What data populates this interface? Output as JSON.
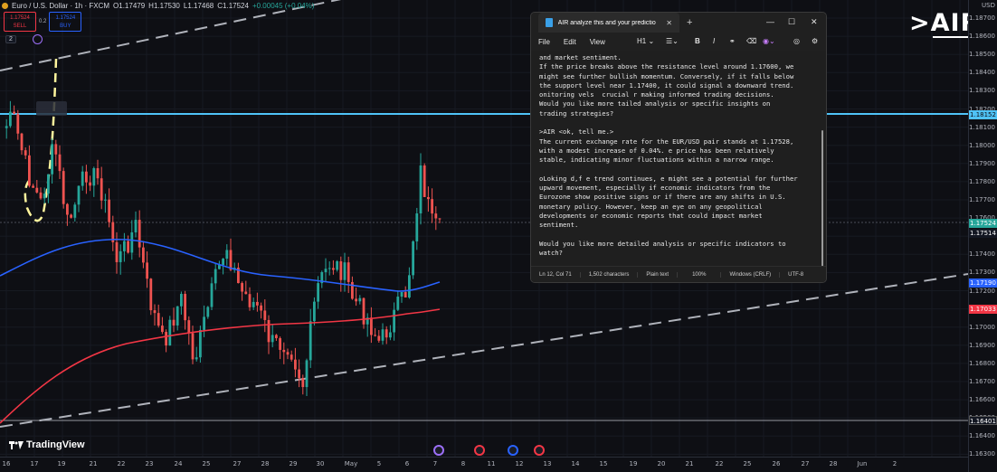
{
  "symbol": {
    "title": "Euro / U.S. Dollar · 1h · FXCM",
    "open": "O1.17479",
    "high": "H1.17530",
    "low": "L1.17468",
    "close": "C1.17524",
    "change": "+0.00045 (+0.04%)"
  },
  "trade": {
    "sell_price": "1.17524",
    "sell_label": "SELL",
    "spread": "0.2",
    "buy_price": "1.17524",
    "buy_label": "BUY"
  },
  "indicators_count": "2",
  "air_logo": ">AIR",
  "tradingview_logo": "TradingView",
  "currency": "USD",
  "price_ticks": [
    "1.18700",
    "1.18600",
    "1.18500",
    "1.18400",
    "1.18300",
    "1.18200",
    "1.18100",
    "1.18000",
    "1.17900",
    "1.17800",
    "1.17700",
    "1.17600",
    "1.17500",
    "1.17400",
    "1.17300",
    "1.17200",
    "1.17100",
    "1.17000",
    "1.16900",
    "1.16800",
    "1.16700",
    "1.16600",
    "1.16500",
    "1.16400",
    "1.16300"
  ],
  "price_tags": {
    "resistance": "1.18152",
    "current": "1.17524",
    "current2": "1.17514",
    "ma_blue": "1.17190",
    "ma_red": "1.17033",
    "support": "1.16401"
  },
  "time_ticks": [
    "16",
    "17",
    "19",
    "21",
    "22",
    "23",
    "24",
    "25",
    "27",
    "28",
    "29",
    "30",
    "May",
    "5",
    "6",
    "7",
    "8",
    "11",
    "12",
    "13",
    "14",
    "15",
    "19",
    "20",
    "21",
    "22",
    "25",
    "26",
    "27",
    "28",
    "Jun",
    "2"
  ],
  "notepad": {
    "tab_title": "AIR analyze this and your predictio",
    "menu": [
      "File",
      "Edit",
      "View"
    ],
    "heading_btn": "H1",
    "status": [
      "Ln 12, Col 71",
      "1,502 characters",
      "Plain text",
      "100%",
      "Windows (CRLF)",
      "UTF-8"
    ],
    "text": "and market sentiment.\nIf the price breaks above the resistance level around 1.17600, we\nmight see further bullish momentum. Conversely, if it falls below\nthe support level near 1.17400, it could signal a downward trend.\nonitoring vels  crucial r making informed trading decisions.\nWould you like more tailed analysis or specific insights on\ntrading strategies?\n\n>AIR <ok, tell me.>\nThe current exchange rate for the EUR/USD pair stands at 1.17528,\nwith a modest increase of 0.04%. e price has been relatively\nstable, indicating minor fluctuations within a narrow range.\n\noLoking d,f e trend continues, e might see a potential for further\nupward movement, especially if economic indicators from the\nEurozone show positive signs or if there are any shifts in U.S.\nmonetary policy. However, keep an eye on any geopolitical\ndevelopments or economic reports that could impact market\nsentiment.\n\nWould you like more detailed analysis or specific indicators to\nwatch?"
  },
  "colors": {
    "background": "#0e0f14",
    "up_candle": "#26a69a",
    "down_candle": "#ef5350",
    "ma_blue": "#2962ff",
    "ma_red": "#f23645",
    "resistance_line": "#4fc3f7"
  }
}
